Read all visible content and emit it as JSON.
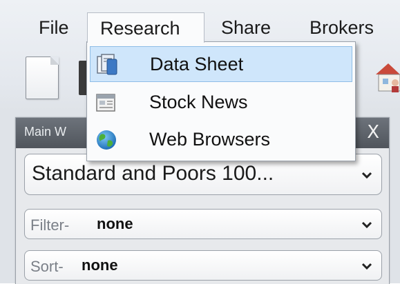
{
  "menubar": {
    "items": [
      {
        "label": "File"
      },
      {
        "label": "Research"
      },
      {
        "label": "Share"
      },
      {
        "label": "Brokers"
      }
    ]
  },
  "research_menu": {
    "items": [
      {
        "label": "Data Sheet",
        "icon": "data-sheet-icon",
        "highlighted": true
      },
      {
        "label": "Stock News",
        "icon": "newspaper-icon",
        "highlighted": false
      },
      {
        "label": "Web Browsers",
        "icon": "globe-icon",
        "highlighted": false
      }
    ]
  },
  "panel": {
    "title": "Main W",
    "close_label": "X",
    "index_select": {
      "value": "Standard and Poors 100..."
    },
    "filter_select": {
      "label": "Filter-",
      "value": "none"
    },
    "sort_select": {
      "label": "Sort-",
      "value": "none"
    }
  },
  "colors": {
    "menu_highlight": "#cfe6fb",
    "panel_header": "#5c6168"
  }
}
